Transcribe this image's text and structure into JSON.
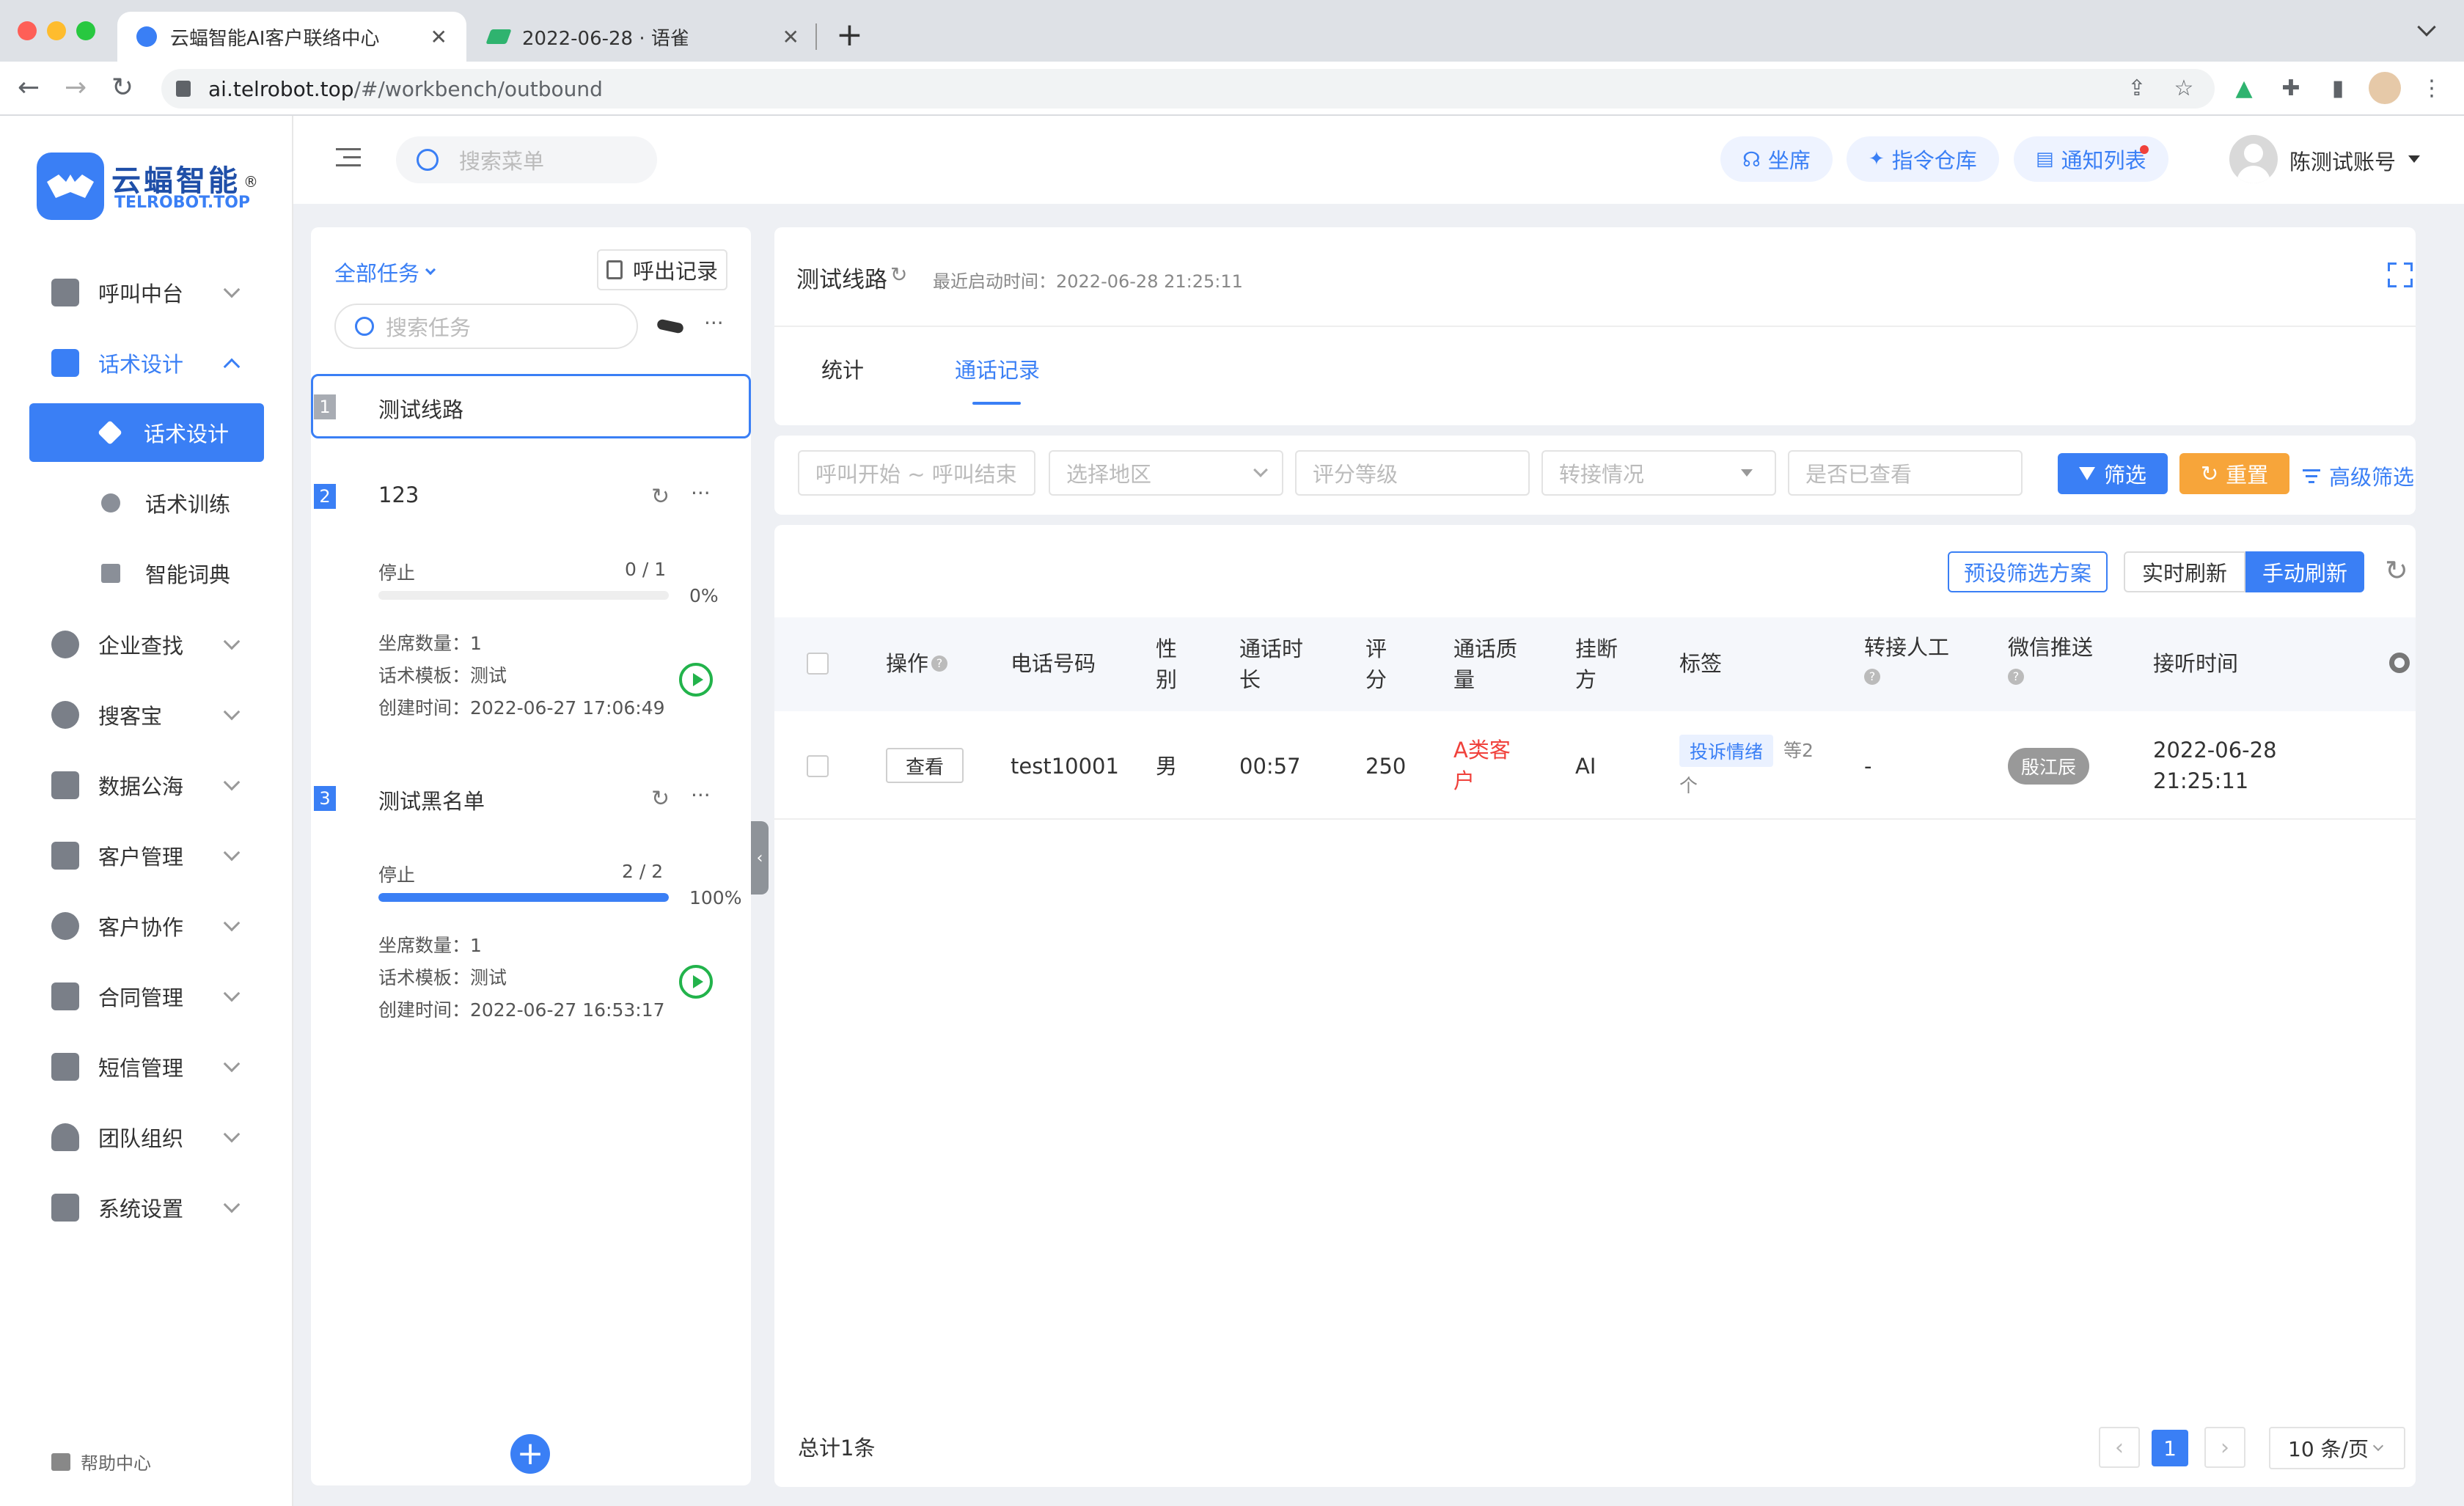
{
  "browser": {
    "tabs": [
      {
        "title": "云蝠智能AI客户联络中心",
        "active": true
      },
      {
        "title": "2022-06-28 · 语雀",
        "active": false
      }
    ],
    "url_domain": "ai.telrobot.top",
    "url_path": "/#/workbench/outbound"
  },
  "brand": {
    "name": "云蝠智能",
    "sub": "TELROBOT.TOP",
    "reg": "®"
  },
  "topbar": {
    "search_placeholder": "搜索菜单",
    "btn_seat": "坐席",
    "btn_cmd": "指令仓库",
    "btn_notice": "通知列表",
    "user": "陈测试账号"
  },
  "sidebar": {
    "items": [
      {
        "label": "呼叫中台"
      },
      {
        "label": "话术设计"
      },
      {
        "label": "企业查找"
      },
      {
        "label": "搜客宝"
      },
      {
        "label": "数据公海"
      },
      {
        "label": "客户管理"
      },
      {
        "label": "客户协作"
      },
      {
        "label": "合同管理"
      },
      {
        "label": "短信管理"
      },
      {
        "label": "团队组织"
      },
      {
        "label": "系统设置"
      }
    ],
    "subitems": [
      {
        "label": "话术设计"
      },
      {
        "label": "话术训练"
      },
      {
        "label": "智能词典"
      }
    ],
    "help": "帮助中心"
  },
  "tasks": {
    "filter": "全部任务",
    "call_record_btn": "呼出记录",
    "search_placeholder": "搜索任务",
    "more": "···",
    "list": [
      {
        "num": "1",
        "name": "测试线路"
      },
      {
        "num": "2",
        "name": "123",
        "status": "停止",
        "count": "0 / 1",
        "percent": "0%",
        "progress": 0,
        "seats": "坐席数量：1",
        "template": "话术模板：测试",
        "created": "创建时间：2022-06-27 17:06:49"
      },
      {
        "num": "3",
        "name": "测试黑名单",
        "status": "停止",
        "count": "2 / 2",
        "percent": "100%",
        "progress": 1,
        "seats": "坐席数量：1",
        "template": "话术模板：测试",
        "created": "创建时间：2022-06-27 16:53:17"
      }
    ]
  },
  "main": {
    "title": "测试线路",
    "last_start": "最近启动时间：2022-06-28 21:25:11",
    "tabs": [
      {
        "label": "统计"
      },
      {
        "label": "通话记录"
      }
    ],
    "filters": {
      "time": "呼叫开始 ~ 呼叫结束",
      "region": "选择地区",
      "grade": "评分等级",
      "transfer": "转接情况",
      "viewed": "是否已查看",
      "btn_filter": "筛选",
      "btn_reset": "重置",
      "btn_advanced": "高级筛选"
    },
    "toolbar": {
      "preset": "预设筛选方案",
      "realtime": "实时刷新",
      "manual": "手动刷新"
    },
    "table": {
      "headers": {
        "op": "操作",
        "phone": "电话号码",
        "gender_1": "性",
        "gender_2": "别",
        "duration_1": "通话时",
        "duration_2": "长",
        "score_1": "评",
        "score_2": "分",
        "quality_1": "通话质",
        "quality_2": "量",
        "hangup_1": "挂断",
        "hangup_2": "方",
        "tags": "标签",
        "transfer": "转接人工",
        "wechat": "微信推送",
        "time": "接听时间"
      },
      "rows": [
        {
          "op": "查看",
          "phone": "test10001",
          "gender": "男",
          "duration": "00:57",
          "score": "250",
          "quality_1": "A类客",
          "quality_2": "户",
          "hangup": "AI",
          "tag": "投诉情绪",
          "tag_more_1": "等2",
          "tag_more_2": "个",
          "transfer": "-",
          "wechat": "殷江辰",
          "time_1": "2022-06-28",
          "time_2": "21:25:11"
        }
      ]
    },
    "total": "总计1条",
    "page": "1",
    "page_size": "10 条/页"
  },
  "colors": {
    "primary": "#3a7ff5",
    "orange": "#f7a53a",
    "danger": "#f0413b",
    "green": "#22b34b"
  }
}
